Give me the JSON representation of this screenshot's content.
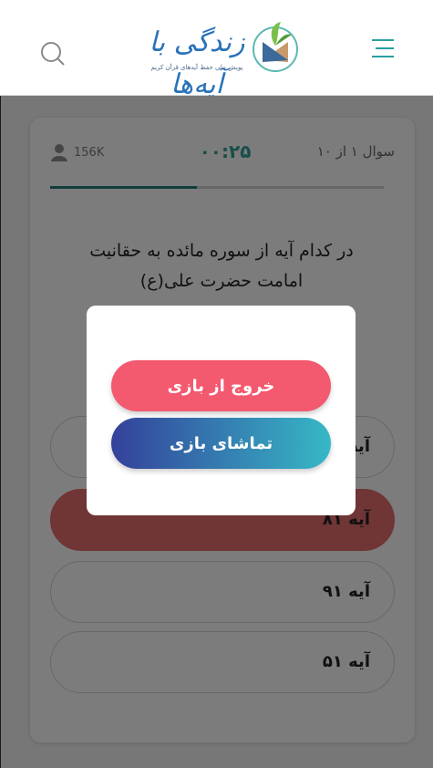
{
  "header": {
    "logo_title": "زندگی با آیه‌ها",
    "logo_subtitle": "پویش ملی حفظ آیه‌های قرآن کریم",
    "search_icon": "search-icon",
    "menu_icon": "hamburger-menu-icon"
  },
  "game": {
    "players": "156K",
    "timer": "۰۰:۲۵",
    "question_number": "سوال ۱ از ۱۰",
    "progress": 0.44,
    "question": "در کدام آیه از سوره مائده به حقانیت امامت حضرت علی(ع)",
    "answers": [
      {
        "label": "آیه"
      },
      {
        "label": "آیه ۸۱",
        "state": "wrong"
      },
      {
        "label": "آیه ۹۱"
      },
      {
        "label": "آیه ۵۱"
      }
    ]
  },
  "modal": {
    "exit_label": "خروج از بازی",
    "watch_label": "تماشای بازی"
  },
  "colors": {
    "accent": "#2f9d95",
    "wrong": "#e06a6a",
    "exit": "#f3596f",
    "watch_start": "#34419a",
    "watch_end": "#36b8c6"
  }
}
